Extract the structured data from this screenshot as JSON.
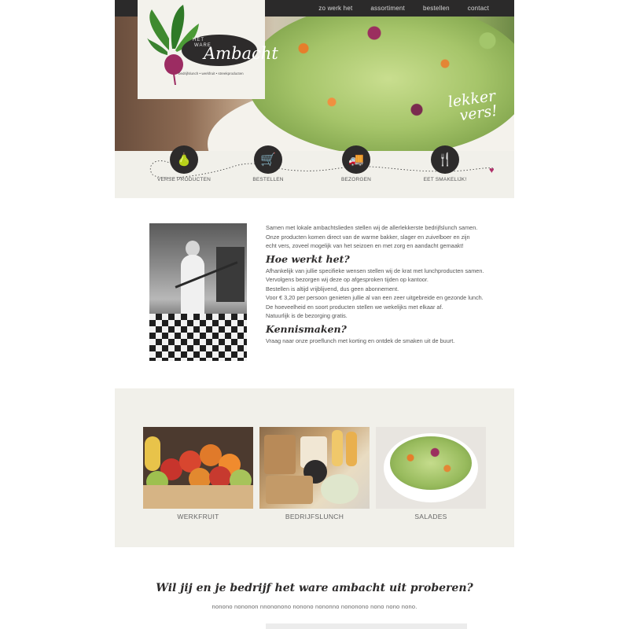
{
  "nav": {
    "items": [
      "zo werk het",
      "assortiment",
      "bestellen",
      "contact"
    ]
  },
  "logo": {
    "het": "HET",
    "ware": "WARE",
    "name": "Ambacht",
    "subtitle": "bedrijfslunch • werkfruit • streekproducten"
  },
  "hero": {
    "tagline_line1": "lekker",
    "tagline_line2": "vers!"
  },
  "steps": [
    {
      "label": "VERSE PRODUCTEN",
      "icon": "pear-icon",
      "glyph": "🍐"
    },
    {
      "label": "BESTELLEN",
      "icon": "cart-icon",
      "glyph": "🛒"
    },
    {
      "label": "BEZORGEN",
      "icon": "truck-icon",
      "glyph": "🚚"
    },
    {
      "label": "EET SMAKELIJK!",
      "icon": "cutlery-icon",
      "glyph": "🍴"
    }
  ],
  "about": {
    "intro": [
      "Samen met lokale ambachtslieden stellen wij de allerlekkerste bedrijfslunch samen.",
      "Onze producten komen direct van de warme bakker, slager en zuivelboer en zijn",
      "echt vers, zoveel mogelijk van het seizoen en met zorg en aandacht gemaakt!"
    ],
    "how_title": "Hoe werkt het?",
    "how": [
      "Afhankelijk van jullie specifieke wensen stellen wij de krat met lunchproducten samen.",
      "Vervolgens bezorgen wij deze op afgesproken tijden op kantoor.",
      "Bestellen is altijd vrijblijvend, dus geen abonnement.",
      "Voor € 3,20 per persoon genieten jullie al van een zeer uitgebreide en gezonde lunch.",
      "De hoeveelheid en soort producten stellen we wekelijks met elkaar af.",
      "Natuurlijk is de bezorging gratis."
    ],
    "meet_title": "Kennismaken?",
    "meet": "Vraag naar onze proeflunch met korting en ontdek de smaken uit de buurt."
  },
  "products": [
    {
      "caption": "WERKFRUIT"
    },
    {
      "caption": "BEDRIJFSLUNCH"
    },
    {
      "caption": "SALADES"
    }
  ],
  "cta": {
    "title": "Wil jij en je bedrijf het ware ambacht uit proberen?",
    "subtitle": "nonono nononon nnononono nonono nononno nononono nono nono nono."
  },
  "colors": {
    "dark": "#2b2a2a",
    "cream": "#f1f0ea",
    "accent": "#b0306a"
  }
}
